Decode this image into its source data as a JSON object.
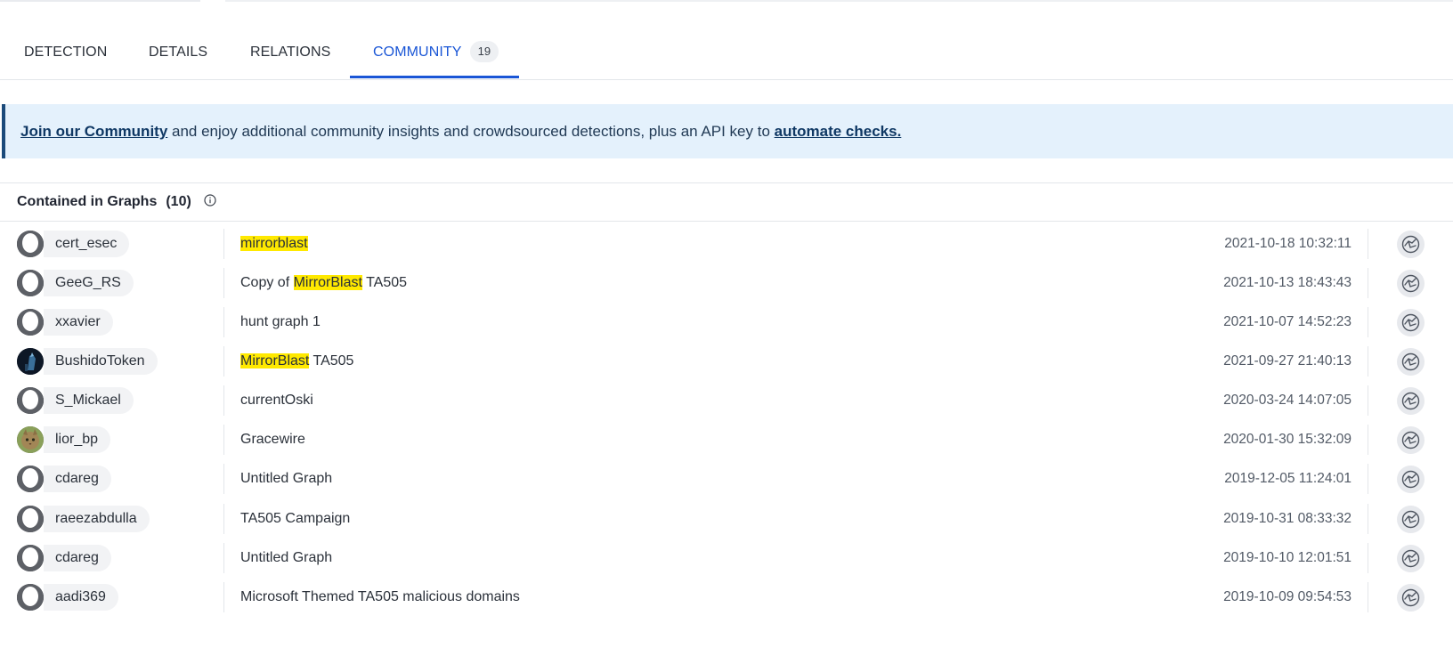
{
  "tabs": [
    {
      "label": "DETECTION"
    },
    {
      "label": "DETAILS"
    },
    {
      "label": "RELATIONS"
    },
    {
      "label": "COMMUNITY",
      "badge": "19",
      "active": true
    }
  ],
  "banner": {
    "link1": "Join our Community",
    "text": " and enjoy additional community insights and crowdsourced detections, plus an API key to ",
    "link2": "automate checks."
  },
  "graphs_section": {
    "title": "Contained in Graphs",
    "count": "(10)",
    "rows": [
      {
        "user": "cert_esec",
        "avatar": "default",
        "name_parts": [
          {
            "t": "mirrorblast",
            "hl": true
          }
        ],
        "date": "2021-10-18 10:32:11"
      },
      {
        "user": "GeeG_RS",
        "avatar": "default",
        "name_parts": [
          {
            "t": "Copy of ",
            "hl": false
          },
          {
            "t": "MirrorBlast",
            "hl": true
          },
          {
            "t": " TA505",
            "hl": false
          }
        ],
        "date": "2021-10-13 18:43:43"
      },
      {
        "user": "xxavier",
        "avatar": "default",
        "name_parts": [
          {
            "t": "hunt graph 1",
            "hl": false
          }
        ],
        "date": "2021-10-07 14:52:23"
      },
      {
        "user": "BushidoToken",
        "avatar": "photo-dark",
        "name_parts": [
          {
            "t": "MirrorBlast",
            "hl": true
          },
          {
            "t": " TA505",
            "hl": false
          }
        ],
        "date": "2021-09-27 21:40:13"
      },
      {
        "user": "S_Mickael",
        "avatar": "default",
        "name_parts": [
          {
            "t": "currentOski",
            "hl": false
          }
        ],
        "date": "2020-03-24 14:07:05"
      },
      {
        "user": "lior_bp",
        "avatar": "photo-cat",
        "name_parts": [
          {
            "t": "Gracewire",
            "hl": false
          }
        ],
        "date": "2020-01-30 15:32:09"
      },
      {
        "user": "cdareg",
        "avatar": "default",
        "name_parts": [
          {
            "t": "Untitled Graph",
            "hl": false
          }
        ],
        "date": "2019-12-05 11:24:01"
      },
      {
        "user": "raeezabdulla",
        "avatar": "default",
        "name_parts": [
          {
            "t": "TA505 Campaign",
            "hl": false
          }
        ],
        "date": "2019-10-31 08:33:32"
      },
      {
        "user": "cdareg",
        "avatar": "default",
        "name_parts": [
          {
            "t": "Untitled Graph",
            "hl": false
          }
        ],
        "date": "2019-10-10 12:01:51"
      },
      {
        "user": "aadi369",
        "avatar": "default",
        "name_parts": [
          {
            "t": "Microsoft Themed TA505 malicious domains",
            "hl": false
          }
        ],
        "date": "2019-10-09 09:54:53"
      }
    ]
  },
  "colors": {
    "accent": "#1a56d6",
    "highlight": "#ffe900",
    "banner_bg": "#e4f1fc",
    "banner_border": "#1b4a7a"
  },
  "icons": {
    "info": "info-circle-icon",
    "graph_button": "graph-icon",
    "avatar_default": "user-silhouette-icon"
  }
}
